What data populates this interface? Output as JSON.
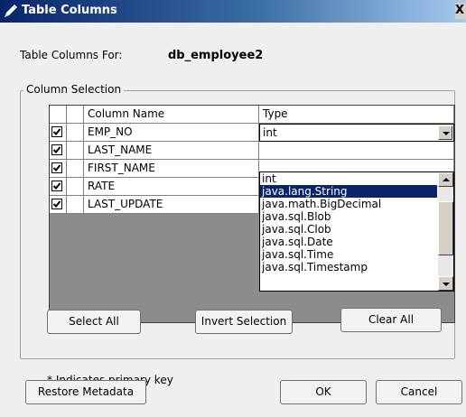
{
  "window": {
    "title": "Table Columns",
    "close_glyph": "X"
  },
  "header": {
    "for_label": "Table Columns For:",
    "for_value": "db_employee2"
  },
  "group": {
    "legend": "Column Selection"
  },
  "table": {
    "headers": [
      "",
      "",
      "Column Name",
      "Type"
    ],
    "rows": [
      {
        "checked": true,
        "name": "EMP_NO",
        "type": "int"
      },
      {
        "checked": true,
        "name": "LAST_NAME",
        "type": ""
      },
      {
        "checked": true,
        "name": "FIRST_NAME",
        "type": ""
      },
      {
        "checked": true,
        "name": "RATE",
        "type": ""
      },
      {
        "checked": true,
        "name": "LAST_UPDATE",
        "type": ""
      }
    ]
  },
  "dropdown": {
    "selected": "java.lang.String",
    "items": [
      "int",
      "java.lang.String",
      "java.math.BigDecimal",
      "java.sql.Blob",
      "java.sql.Clob",
      "java.sql.Date",
      "java.sql.Time",
      "java.sql.Timestamp"
    ]
  },
  "buttons": {
    "select_all": "Select All",
    "invert_selection": "Invert Selection",
    "clear_all": "Clear All",
    "restore_metadata": "Restore Metadata",
    "ok": "OK",
    "cancel": "Cancel"
  },
  "note": "* Indicates primary key",
  "colors": {
    "title_gradient_start": "#0a246a",
    "title_gradient_end": "#a6caf0",
    "selection": "#0a246a",
    "table_background": "#8c8c8c"
  }
}
